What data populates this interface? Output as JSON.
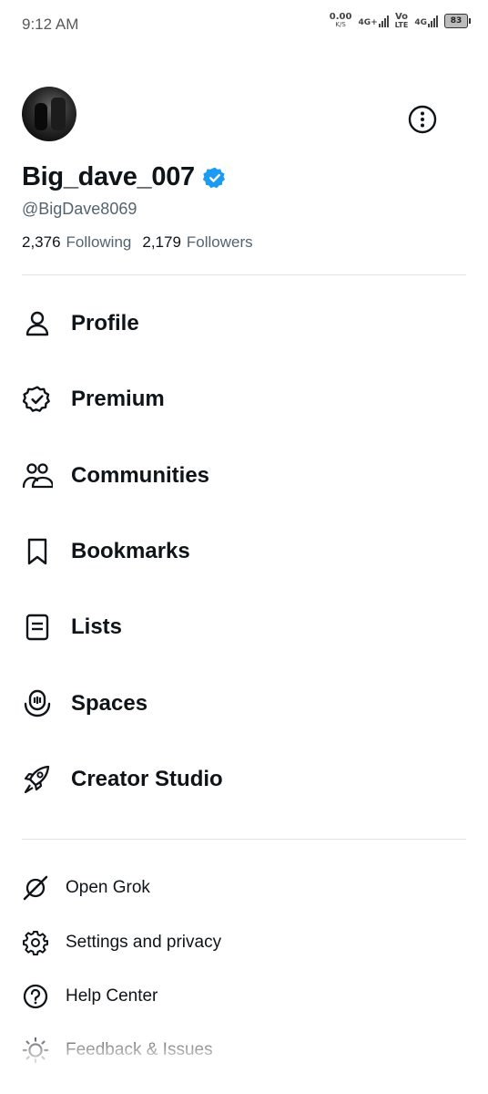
{
  "status_bar": {
    "time": "9:12 AM",
    "speed_value": "0.00",
    "speed_unit": "K/S",
    "net1": "4G+",
    "volte_top": "Vo",
    "volte_bottom": "LTE",
    "net2": "4G",
    "battery": "83"
  },
  "profile": {
    "display_name": "Big_dave_007",
    "handle": "@BigDave8069",
    "following_count": "2,376",
    "following_label": "Following",
    "followers_count": "2,179",
    "followers_label": "Followers",
    "verified_color": "#1d9bf0"
  },
  "menu": [
    {
      "label": "Profile",
      "icon": "person-icon"
    },
    {
      "label": "Premium",
      "icon": "verified-badge-icon"
    },
    {
      "label": "Communities",
      "icon": "communities-icon"
    },
    {
      "label": "Bookmarks",
      "icon": "bookmark-icon"
    },
    {
      "label": "Lists",
      "icon": "list-icon"
    },
    {
      "label": "Spaces",
      "icon": "spaces-mic-icon"
    },
    {
      "label": "Creator Studio",
      "icon": "rocket-icon"
    }
  ],
  "secondary_menu": [
    {
      "label": "Open Grok",
      "icon": "grok-icon"
    },
    {
      "label": "Settings and privacy",
      "icon": "gear-icon"
    },
    {
      "label": "Help Center",
      "icon": "help-icon"
    },
    {
      "label": "Feedback & Issues",
      "icon": "sun-icon"
    }
  ]
}
